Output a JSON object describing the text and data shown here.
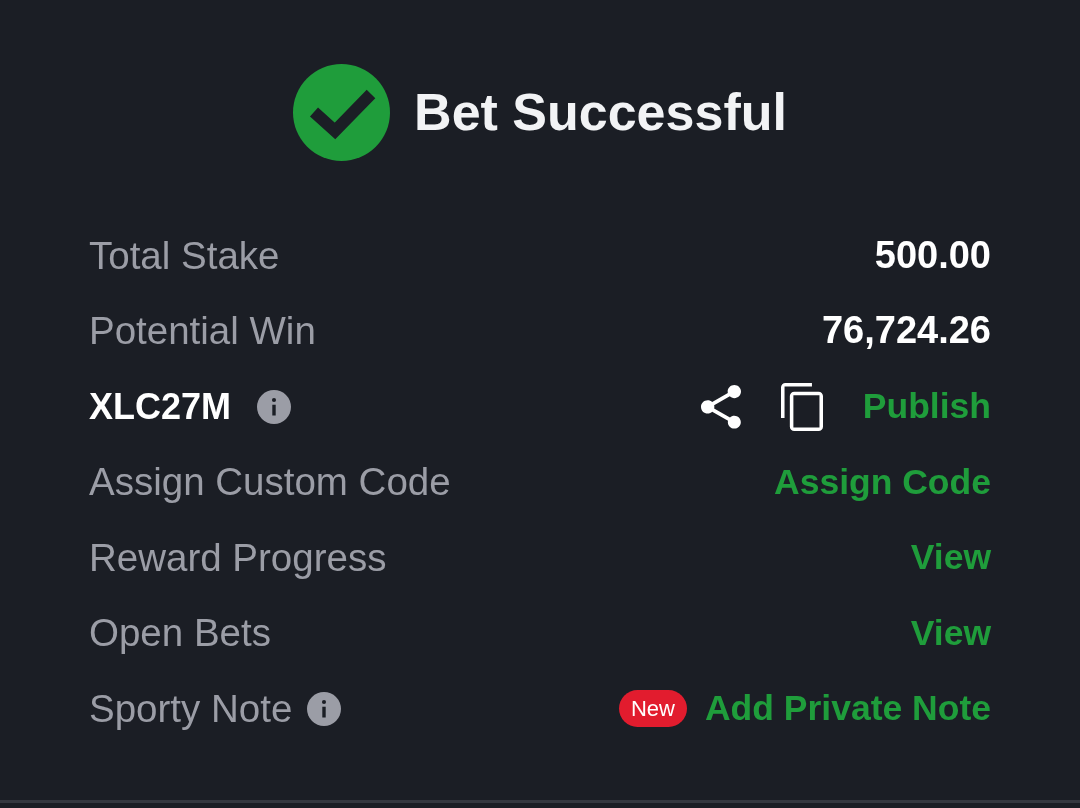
{
  "header": {
    "title": "Bet Successful"
  },
  "rows": [
    {
      "kind": "amount",
      "label": "Total Stake",
      "info": false,
      "value": "500.00"
    },
    {
      "kind": "amount",
      "label": "Potential Win",
      "info": false,
      "value": "76,724.26"
    },
    {
      "kind": "code",
      "label": "XLC27M",
      "info": true,
      "link": "Publish"
    },
    {
      "kind": "link",
      "label": "Assign Custom Code",
      "info": false,
      "link": "Assign Code"
    },
    {
      "kind": "link",
      "label": "Reward Progress",
      "info": false,
      "link": "View"
    },
    {
      "kind": "link",
      "label": "Open Bets",
      "info": false,
      "link": "View"
    },
    {
      "kind": "link",
      "label": "Sporty Note",
      "info": true,
      "badge": "New",
      "link": "Add Private Note"
    }
  ]
}
